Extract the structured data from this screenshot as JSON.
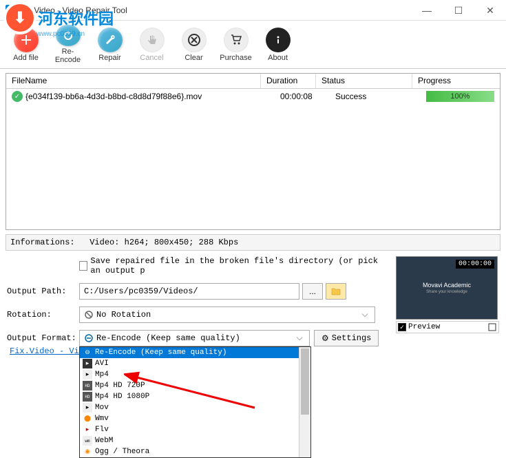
{
  "window": {
    "title": "Fix.Video - Video Repair Tool"
  },
  "watermark": {
    "text": "河东软件园",
    "url": "www.pc0359.cn"
  },
  "toolbar": {
    "add_file": "Add file",
    "re_encode": "Re-Encode",
    "repair": "Repair",
    "cancel": "Cancel",
    "clear": "Clear",
    "purchase": "Purchase",
    "about": "About"
  },
  "table": {
    "headers": {
      "filename": "FileName",
      "duration": "Duration",
      "status": "Status",
      "progress": "Progress"
    },
    "rows": [
      {
        "filename": "{e034f139-bb6a-4d3d-b8bd-c8d8d79f88e6}.mov",
        "duration": "00:00:08",
        "status": "Success",
        "progress": "100%"
      }
    ]
  },
  "info": {
    "label": "Informations:",
    "value": "Video: h264; 800x450; 288 Kbps"
  },
  "options": {
    "save_checkbox": "Save repaired file in the broken file's directory (or pick an output p",
    "output_path_label": "Output Path:",
    "output_path_value": "C:/Users/pc0359/Videos/",
    "rotation_label": "Rotation:",
    "rotation_value": "No Rotation",
    "format_label": "Output Format:",
    "format_value": "Re-Encode (Keep same quality)",
    "settings_btn": "Settings",
    "format_options": [
      "Re-Encode (Keep same quality)",
      "AVI",
      "Mp4",
      "Mp4 HD 720P",
      "Mp4 HD 1080P",
      "Mov",
      "Wmv",
      "Flv",
      "WebM",
      "Ogg / Theora"
    ]
  },
  "preview": {
    "time": "00:00:00",
    "title": "Movavi Academic",
    "subtitle": "Share your knowledge",
    "checkbox_label": "Preview"
  },
  "footer": {
    "link": "Fix.Video - Vide"
  }
}
